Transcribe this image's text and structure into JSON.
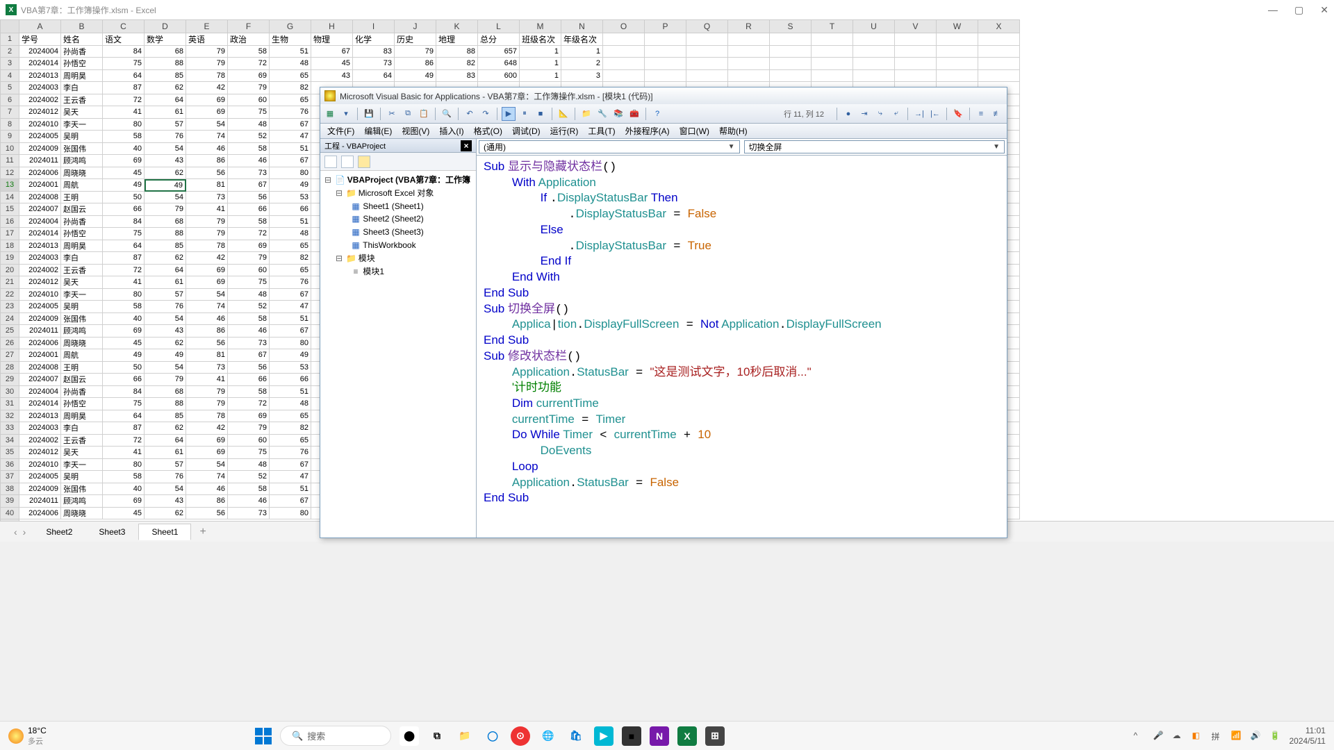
{
  "excel": {
    "title": "VBA第7章：工作簿操作.xlsm - Excel",
    "columns": [
      "A",
      "B",
      "C",
      "D",
      "E",
      "F",
      "G",
      "H",
      "I",
      "J",
      "K",
      "L",
      "M",
      "N",
      "O",
      "P",
      "Q",
      "R",
      "S",
      "T",
      "U",
      "V",
      "W",
      "X"
    ],
    "row_count": 41,
    "selected_row": 13,
    "selected_cell": "D13",
    "headers": [
      "学号",
      "姓名",
      "语文",
      "数学",
      "英语",
      "政治",
      "生物",
      "物理",
      "化学",
      "历史",
      "地理",
      "总分",
      "班级名次",
      "年级名次"
    ],
    "rows": [
      [
        "2024004",
        "孙尚香",
        "84",
        "68",
        "79",
        "58",
        "51",
        "67",
        "83",
        "79",
        "88",
        "657",
        "1",
        "1"
      ],
      [
        "2024014",
        "孙悟空",
        "75",
        "88",
        "79",
        "72",
        "48",
        "45",
        "73",
        "86",
        "82",
        "648",
        "1",
        "2"
      ],
      [
        "2024013",
        "周明昊",
        "64",
        "85",
        "78",
        "69",
        "65",
        "43",
        "64",
        "49",
        "83",
        "600",
        "1",
        "3"
      ],
      [
        "2024003",
        "李白",
        "87",
        "62",
        "42",
        "79",
        "82",
        "",
        "",
        "",
        "",
        "",
        "",
        ""
      ],
      [
        "2024002",
        "王云香",
        "72",
        "64",
        "69",
        "60",
        "65",
        "",
        "",
        "",
        "",
        "",
        "",
        ""
      ],
      [
        "2024012",
        "吴天",
        "41",
        "61",
        "69",
        "75",
        "76",
        "",
        "",
        "",
        "",
        "",
        "",
        ""
      ],
      [
        "2024010",
        "李天一",
        "80",
        "57",
        "54",
        "48",
        "67",
        "",
        "",
        "",
        "",
        "",
        "",
        ""
      ],
      [
        "2024005",
        "吴明",
        "58",
        "76",
        "74",
        "52",
        "47",
        "",
        "",
        "",
        "",
        "",
        "",
        ""
      ],
      [
        "2024009",
        "张国伟",
        "40",
        "54",
        "46",
        "58",
        "51",
        "",
        "",
        "",
        "",
        "",
        "",
        ""
      ],
      [
        "2024011",
        "顾鸿鸣",
        "69",
        "43",
        "86",
        "46",
        "67",
        "",
        "",
        "",
        "",
        "",
        "",
        ""
      ],
      [
        "2024006",
        "周晓晓",
        "45",
        "62",
        "56",
        "73",
        "80",
        "",
        "",
        "",
        "",
        "",
        "",
        ""
      ],
      [
        "2024001",
        "周航",
        "49",
        "49",
        "81",
        "67",
        "49",
        "",
        "",
        "",
        "",
        "",
        "",
        ""
      ],
      [
        "2024008",
        "王明",
        "50",
        "54",
        "73",
        "56",
        "53",
        "",
        "",
        "",
        "",
        "",
        "",
        ""
      ],
      [
        "2024007",
        "赵国云",
        "66",
        "79",
        "41",
        "66",
        "66",
        "",
        "",
        "",
        "",
        "",
        "",
        ""
      ],
      [
        "2024004",
        "孙尚香",
        "84",
        "68",
        "79",
        "58",
        "51",
        "",
        "",
        "",
        "",
        "",
        "",
        ""
      ],
      [
        "2024014",
        "孙悟空",
        "75",
        "88",
        "79",
        "72",
        "48",
        "",
        "",
        "",
        "",
        "",
        "",
        ""
      ],
      [
        "2024013",
        "周明昊",
        "64",
        "85",
        "78",
        "69",
        "65",
        "",
        "",
        "",
        "",
        "",
        "",
        ""
      ],
      [
        "2024003",
        "李白",
        "87",
        "62",
        "42",
        "79",
        "82",
        "",
        "",
        "",
        "",
        "",
        "",
        ""
      ],
      [
        "2024002",
        "王云香",
        "72",
        "64",
        "69",
        "60",
        "65",
        "",
        "",
        "",
        "",
        "",
        "",
        ""
      ],
      [
        "2024012",
        "吴天",
        "41",
        "61",
        "69",
        "75",
        "76",
        "",
        "",
        "",
        "",
        "",
        "",
        ""
      ],
      [
        "2024010",
        "李天一",
        "80",
        "57",
        "54",
        "48",
        "67",
        "",
        "",
        "",
        "",
        "",
        "",
        ""
      ],
      [
        "2024005",
        "吴明",
        "58",
        "76",
        "74",
        "52",
        "47",
        "",
        "",
        "",
        "",
        "",
        "",
        ""
      ],
      [
        "2024009",
        "张国伟",
        "40",
        "54",
        "46",
        "58",
        "51",
        "",
        "",
        "",
        "",
        "",
        "",
        ""
      ],
      [
        "2024011",
        "顾鸿鸣",
        "69",
        "43",
        "86",
        "46",
        "67",
        "",
        "",
        "",
        "",
        "",
        "",
        ""
      ],
      [
        "2024006",
        "周晓晓",
        "45",
        "62",
        "56",
        "73",
        "80",
        "",
        "",
        "",
        "",
        "",
        "",
        ""
      ],
      [
        "2024001",
        "周航",
        "49",
        "49",
        "81",
        "67",
        "49",
        "",
        "",
        "",
        "",
        "",
        "",
        ""
      ],
      [
        "2024008",
        "王明",
        "50",
        "54",
        "73",
        "56",
        "53",
        "",
        "",
        "",
        "",
        "",
        "",
        ""
      ],
      [
        "2024007",
        "赵国云",
        "66",
        "79",
        "41",
        "66",
        "66",
        "",
        "",
        "",
        "",
        "",
        "",
        ""
      ],
      [
        "2024004",
        "孙尚香",
        "84",
        "68",
        "79",
        "58",
        "51",
        "",
        "",
        "",
        "",
        "",
        "",
        ""
      ],
      [
        "2024014",
        "孙悟空",
        "75",
        "88",
        "79",
        "72",
        "48",
        "",
        "",
        "",
        "",
        "",
        "",
        ""
      ],
      [
        "2024013",
        "周明昊",
        "64",
        "85",
        "78",
        "69",
        "65",
        "",
        "",
        "",
        "",
        "",
        "",
        ""
      ],
      [
        "2024003",
        "李白",
        "87",
        "62",
        "42",
        "79",
        "82",
        "",
        "",
        "",
        "",
        "",
        "",
        ""
      ],
      [
        "2024002",
        "王云香",
        "72",
        "64",
        "69",
        "60",
        "65",
        "",
        "",
        "",
        "",
        "",
        "",
        ""
      ],
      [
        "2024012",
        "吴天",
        "41",
        "61",
        "69",
        "75",
        "76",
        "",
        "",
        "",
        "",
        "",
        "",
        ""
      ],
      [
        "2024010",
        "李天一",
        "80",
        "57",
        "54",
        "48",
        "67",
        "",
        "",
        "",
        "",
        "",
        "",
        ""
      ],
      [
        "2024005",
        "吴明",
        "58",
        "76",
        "74",
        "52",
        "47",
        "",
        "",
        "",
        "",
        "",
        "",
        ""
      ],
      [
        "2024009",
        "张国伟",
        "40",
        "54",
        "46",
        "58",
        "51",
        "",
        "",
        "",
        "",
        "",
        "",
        ""
      ],
      [
        "2024011",
        "顾鸿鸣",
        "69",
        "43",
        "86",
        "46",
        "67",
        "",
        "",
        "",
        "",
        "",
        "",
        ""
      ],
      [
        "2024006",
        "周晓晓",
        "45",
        "62",
        "56",
        "73",
        "80",
        "",
        "",
        "",
        "",
        "",
        "",
        ""
      ]
    ],
    "sheets": [
      "Sheet2",
      "Sheet3",
      "Sheet1"
    ],
    "active_sheet": "Sheet1"
  },
  "vba": {
    "title": "Microsoft Visual Basic for Applications - VBA第7章：工作簿操作.xlsm - [模块1 (代码)]",
    "cursor_loc": "行 11, 列 12",
    "menu": [
      "文件(F)",
      "编辑(E)",
      "视图(V)",
      "插入(I)",
      "格式(O)",
      "调试(D)",
      "运行(R)",
      "工具(T)",
      "外接程序(A)",
      "窗口(W)",
      "帮助(H)"
    ],
    "project_title": "工程 - VBAProject",
    "tree": {
      "root": "VBAProject (VBA第7章：工作簿",
      "excel_objects": "Microsoft Excel 对象",
      "sheets": [
        "Sheet1 (Sheet1)",
        "Sheet2 (Sheet2)",
        "Sheet3 (Sheet3)"
      ],
      "thisworkbook": "ThisWorkbook",
      "modules_folder": "模块",
      "module1": "模块1"
    },
    "dd_left": "(通用)",
    "dd_right": "切换全屏",
    "code_lines": [
      {
        "indent": 0,
        "tokens": [
          {
            "t": "Sub ",
            "c": "kw"
          },
          {
            "t": "显示与隐藏状态栏",
            "c": "fn"
          },
          {
            "t": "()",
            "c": ""
          }
        ]
      },
      {
        "indent": 1,
        "tokens": [
          {
            "t": "With ",
            "c": "kw"
          },
          {
            "t": "Application",
            "c": "obj"
          }
        ]
      },
      {
        "indent": 2,
        "tokens": [
          {
            "t": "If ",
            "c": "kw"
          },
          {
            "t": ".",
            "c": ""
          },
          {
            "t": "DisplayStatusBar",
            "c": "obj"
          },
          {
            "t": " Then",
            "c": "kw"
          }
        ]
      },
      {
        "indent": 3,
        "tokens": [
          {
            "t": ".",
            "c": ""
          },
          {
            "t": "DisplayStatusBar",
            "c": "obj"
          },
          {
            "t": " = ",
            "c": ""
          },
          {
            "t": "False",
            "c": "bool"
          }
        ]
      },
      {
        "indent": 2,
        "tokens": [
          {
            "t": "Else",
            "c": "kw"
          }
        ]
      },
      {
        "indent": 3,
        "tokens": [
          {
            "t": ".",
            "c": ""
          },
          {
            "t": "DisplayStatusBar",
            "c": "obj"
          },
          {
            "t": " = ",
            "c": ""
          },
          {
            "t": "True",
            "c": "bool"
          }
        ]
      },
      {
        "indent": 2,
        "tokens": [
          {
            "t": "End If",
            "c": "kw"
          }
        ]
      },
      {
        "indent": 1,
        "tokens": [
          {
            "t": "End With",
            "c": "kw"
          }
        ]
      },
      {
        "indent": 0,
        "tokens": [
          {
            "t": "End Sub",
            "c": "kw"
          }
        ]
      },
      {
        "indent": 0,
        "tokens": [
          {
            "t": "Sub ",
            "c": "kw"
          },
          {
            "t": "切换全屏",
            "c": "fn"
          },
          {
            "t": "()",
            "c": ""
          }
        ]
      },
      {
        "indent": 1,
        "tokens": [
          {
            "t": "Applica",
            "c": "obj"
          },
          {
            "t": "|",
            "c": ""
          },
          {
            "t": "tion",
            "c": "obj"
          },
          {
            "t": ".",
            "c": ""
          },
          {
            "t": "DisplayFullScreen",
            "c": "obj"
          },
          {
            "t": " = ",
            "c": ""
          },
          {
            "t": "Not ",
            "c": "kw"
          },
          {
            "t": "Application",
            "c": "obj"
          },
          {
            "t": ".",
            "c": ""
          },
          {
            "t": "DisplayFullScreen",
            "c": "obj"
          }
        ]
      },
      {
        "indent": 0,
        "tokens": [
          {
            "t": "End Sub",
            "c": "kw"
          }
        ]
      },
      {
        "indent": 0,
        "tokens": [
          {
            "t": "Sub ",
            "c": "kw"
          },
          {
            "t": "修改状态栏",
            "c": "fn"
          },
          {
            "t": "()",
            "c": ""
          }
        ]
      },
      {
        "indent": 1,
        "tokens": [
          {
            "t": "Application",
            "c": "obj"
          },
          {
            "t": ".",
            "c": ""
          },
          {
            "t": "StatusBar",
            "c": "obj"
          },
          {
            "t": " = ",
            "c": ""
          },
          {
            "t": "\"这是测试文字，10秒后取消...\"",
            "c": "str"
          }
        ]
      },
      {
        "indent": 1,
        "tokens": [
          {
            "t": "'计时功能",
            "c": "comment"
          }
        ]
      },
      {
        "indent": 1,
        "tokens": [
          {
            "t": "Dim ",
            "c": "kw"
          },
          {
            "t": "currentTime",
            "c": "obj"
          }
        ]
      },
      {
        "indent": 1,
        "tokens": [
          {
            "t": "currentTime",
            "c": "obj"
          },
          {
            "t": " = ",
            "c": ""
          },
          {
            "t": "Timer",
            "c": "obj"
          }
        ]
      },
      {
        "indent": 1,
        "tokens": [
          {
            "t": "Do While ",
            "c": "kw"
          },
          {
            "t": "Timer",
            "c": "obj"
          },
          {
            "t": " < ",
            "c": ""
          },
          {
            "t": "currentTime",
            "c": "obj"
          },
          {
            "t": " + ",
            "c": ""
          },
          {
            "t": "10",
            "c": "num-lit"
          }
        ]
      },
      {
        "indent": 2,
        "tokens": [
          {
            "t": "DoEvents",
            "c": "obj"
          }
        ]
      },
      {
        "indent": 1,
        "tokens": [
          {
            "t": "Loop",
            "c": "kw"
          }
        ]
      },
      {
        "indent": 1,
        "tokens": [
          {
            "t": "Application",
            "c": "obj"
          },
          {
            "t": ".",
            "c": ""
          },
          {
            "t": "StatusBar",
            "c": "obj"
          },
          {
            "t": " = ",
            "c": ""
          },
          {
            "t": "False",
            "c": "bool"
          }
        ]
      },
      {
        "indent": 0,
        "tokens": [
          {
            "t": "End Sub",
            "c": "kw"
          }
        ]
      }
    ]
  },
  "taskbar": {
    "weather_temp": "18°C",
    "weather_desc": "多云",
    "search_placeholder": "搜索",
    "time": "11:01",
    "date": "2024/5/11"
  }
}
